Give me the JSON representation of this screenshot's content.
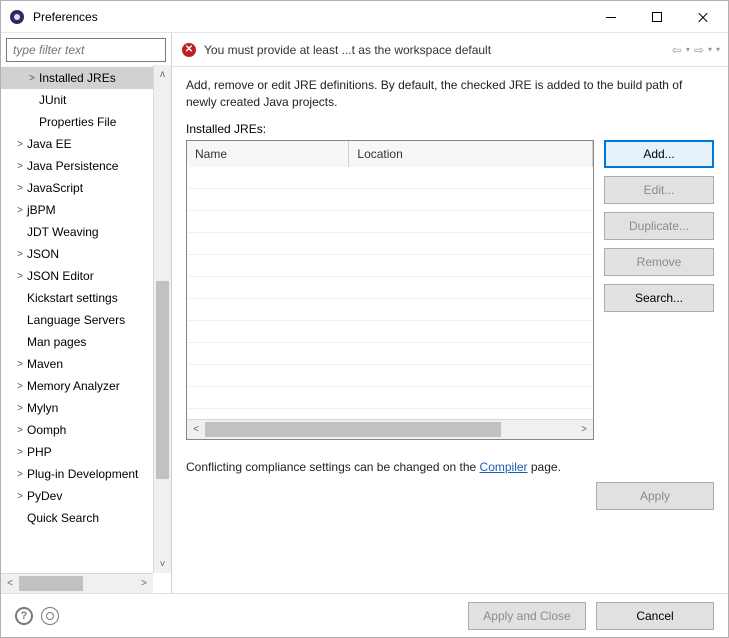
{
  "title": "Preferences",
  "filter_placeholder": "type filter text",
  "tree": [
    {
      "indent": 2,
      "label": "Installed JREs",
      "twisty": ">",
      "selected": true
    },
    {
      "indent": 2,
      "label": "JUnit",
      "twisty": ""
    },
    {
      "indent": 2,
      "label": "Properties File",
      "twisty": ""
    },
    {
      "indent": 1,
      "label": "Java EE",
      "twisty": ">"
    },
    {
      "indent": 1,
      "label": "Java Persistence",
      "twisty": ">"
    },
    {
      "indent": 1,
      "label": "JavaScript",
      "twisty": ">"
    },
    {
      "indent": 1,
      "label": "jBPM",
      "twisty": ">"
    },
    {
      "indent": 1,
      "label": "JDT Weaving",
      "twisty": ""
    },
    {
      "indent": 1,
      "label": "JSON",
      "twisty": ">"
    },
    {
      "indent": 1,
      "label": "JSON Editor",
      "twisty": ">"
    },
    {
      "indent": 1,
      "label": "Kickstart settings",
      "twisty": ""
    },
    {
      "indent": 1,
      "label": "Language Servers",
      "twisty": ""
    },
    {
      "indent": 1,
      "label": "Man pages",
      "twisty": ""
    },
    {
      "indent": 1,
      "label": "Maven",
      "twisty": ">"
    },
    {
      "indent": 1,
      "label": "Memory Analyzer",
      "twisty": ">"
    },
    {
      "indent": 1,
      "label": "Mylyn",
      "twisty": ">"
    },
    {
      "indent": 1,
      "label": "Oomph",
      "twisty": ">"
    },
    {
      "indent": 1,
      "label": "PHP",
      "twisty": ">"
    },
    {
      "indent": 1,
      "label": "Plug-in Development",
      "twisty": ">"
    },
    {
      "indent": 1,
      "label": "PyDev",
      "twisty": ">"
    },
    {
      "indent": 1,
      "label": "Quick Search",
      "twisty": ""
    }
  ],
  "vscroll": {
    "thumb_top_pct": 42,
    "thumb_height_pct": 42
  },
  "hscroll": {
    "thumb_left_pct": 0,
    "thumb_width_pct": 55
  },
  "banner": {
    "error": "You must provide at least ...t as the workspace default"
  },
  "description": "Add, remove or edit JRE definitions. By default, the checked JRE is added to the build path of newly created Java projects.",
  "installed_label": "Installed JREs:",
  "columns": {
    "name": "Name",
    "location": "Location"
  },
  "buttons": {
    "add": "Add...",
    "edit": "Edit...",
    "duplicate": "Duplicate...",
    "remove": "Remove",
    "search": "Search..."
  },
  "compliance": {
    "prefix": "Conflicting compliance settings can be changed on the ",
    "link": "Compiler",
    "suffix": " page."
  },
  "apply": "Apply",
  "footer": {
    "apply_close": "Apply and Close",
    "cancel": "Cancel"
  }
}
